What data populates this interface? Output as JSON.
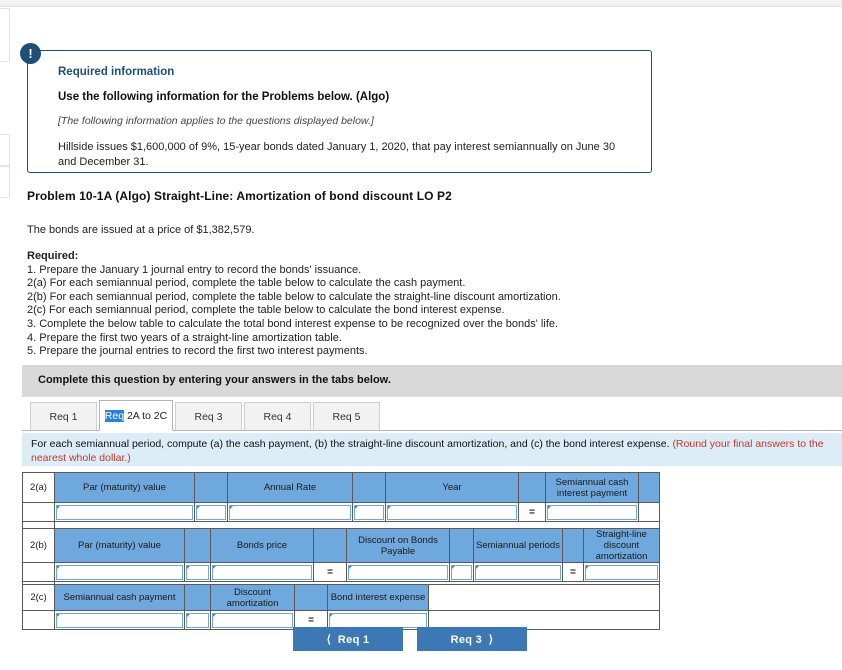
{
  "edge_panels": 3,
  "callout": {
    "badge_icon": "exclamation-icon",
    "badge_glyph": "!",
    "title": "Required information",
    "subtitle": "Use the following information for the Problems below. (Algo)",
    "note": "[The following information applies to the questions displayed below.]",
    "body": "Hillside issues $1,600,000 of 9%, 15-year bonds dated January 1, 2020, that pay interest semiannually on June 30 and December 31."
  },
  "problem": {
    "title": "Problem 10-1A (Algo) Straight-Line: Amortization of bond discount LO P2",
    "price_line": "The bonds are issued at a price of $1,382,579.",
    "required_label": "Required:",
    "requirements": [
      "1. Prepare the January 1 journal entry to record the bonds' issuance.",
      "2(a) For each semiannual period, complete the table below to calculate the cash payment.",
      "2(b) For each semiannual period, complete the table below to calculate the straight-line discount amortization.",
      "2(c) For each semiannual period, complete the table below to calculate the bond interest expense.",
      "3. Complete the below table to calculate the total bond interest expense to be recognized over the bonds' life.",
      "4. Prepare the first two years of a straight-line amortization table.",
      "5. Prepare the journal entries to record the first two interest payments."
    ]
  },
  "gray_bar": {
    "text": "Complete this question by entering your answers in the tabs below."
  },
  "tabs": {
    "items": [
      {
        "label": "Req 1",
        "active": false
      },
      {
        "label": "Req 2A to 2C",
        "active": true,
        "selected_prefix": "Req",
        "rest": " 2A to 2C"
      },
      {
        "label": "Req 3",
        "active": false
      },
      {
        "label": "Req 4",
        "active": false
      },
      {
        "label": "Req 5",
        "active": false
      }
    ]
  },
  "blue_bar": {
    "text": "For each semiannual period, compute (a) the cash payment, (b) the straight-line discount amortization, and (c) the bond interest expense. ",
    "warning": "(Round your final answers to the nearest whole dollar.)"
  },
  "tables": {
    "a": {
      "row_label": "2(a)",
      "headers": [
        "Par (maturity) value",
        "",
        "Annual Rate",
        "",
        "Year",
        "",
        "Semiannual cash interest payment",
        "",
        ""
      ],
      "operators": [
        "",
        "",
        "",
        "",
        "",
        "=",
        "",
        "",
        ""
      ],
      "values": [
        "",
        "",
        "",
        "",
        "",
        "",
        "",
        "",
        ""
      ]
    },
    "b": {
      "row_label": "2(b)",
      "headers": [
        "Par (maturity) value",
        "",
        "Bonds price",
        "",
        "Discount on Bonds Payable",
        "",
        "Semiannual periods",
        "",
        "Straight-line discount amortization"
      ],
      "operators": [
        "",
        "",
        "",
        "=",
        "",
        "",
        "",
        "=",
        ""
      ],
      "values": [
        "",
        "",
        "",
        "",
        "",
        "",
        "",
        "",
        ""
      ]
    },
    "c": {
      "row_label": "2(c)",
      "headers": [
        "Semiannual cash payment",
        "",
        "Discount amortization",
        "",
        "Bond interest expense"
      ],
      "operators": [
        "",
        "",
        "",
        "=",
        ""
      ],
      "values": [
        "",
        "",
        "",
        "",
        ""
      ]
    }
  },
  "nav": {
    "prev_label": "Req 1",
    "prev_icon": "chevron-left-icon",
    "next_label": "Req 3",
    "next_icon": "chevron-right-icon"
  },
  "colors": {
    "callout_border": "#1f4e79",
    "header_blue": "#6fa8dc",
    "button_blue": "#3c78b4",
    "info_bar": "#dcedf7",
    "gray_bar": "#d9d9d9",
    "warning_red": "#c0392b",
    "selection_blue": "#2a7fdb"
  }
}
